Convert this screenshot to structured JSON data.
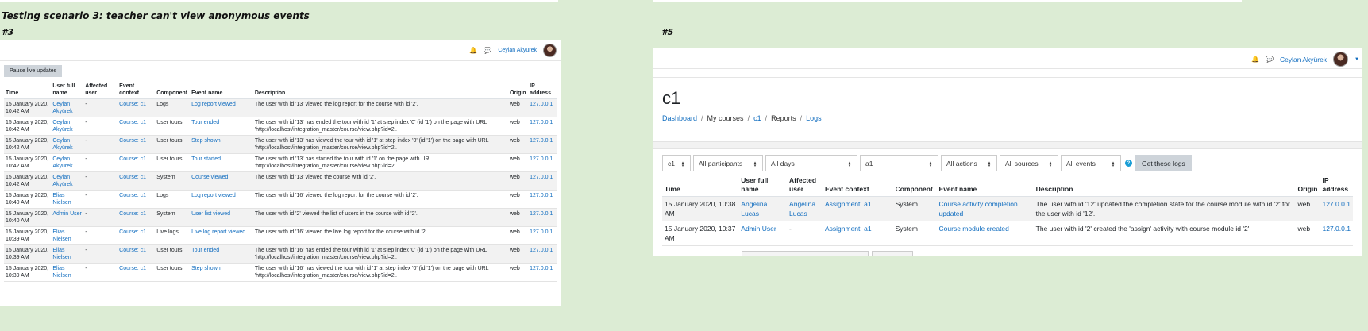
{
  "heading_title": "Testing scenario 3: teacher can't view anonymous events",
  "heading_p3": "#3",
  "heading_p5": "#5",
  "p3": {
    "user_name": "Ceylan Akyürek",
    "pause_button": "Pause live updates",
    "columns": [
      "Time",
      "User full name",
      "Affected user",
      "Event context",
      "Component",
      "Event name",
      "Description",
      "Origin",
      "IP address"
    ],
    "rows": [
      {
        "time": "15 January 2020, 10:42 AM",
        "user": "Ceylan Akyürek",
        "affected": "-",
        "context": "Course: c1",
        "component": "Logs",
        "event": "Log report viewed",
        "description": "The user with id '13' viewed the log report for the course with id '2'.",
        "origin": "web",
        "ip": "127.0.0.1"
      },
      {
        "time": "15 January 2020, 10:42 AM",
        "user": "Ceylan Akyürek",
        "affected": "-",
        "context": "Course: c1",
        "component": "User tours",
        "event": "Tour ended",
        "description": "The user with id '13' has ended the tour with id '1' at step index '0' (id '1') on the page with URL 'http://localhost/integration_master/course/view.php?id=2'.",
        "origin": "web",
        "ip": "127.0.0.1"
      },
      {
        "time": "15 January 2020, 10:42 AM",
        "user": "Ceylan Akyürek",
        "affected": "-",
        "context": "Course: c1",
        "component": "User tours",
        "event": "Step shown",
        "description": "The user with id '13' has viewed the tour with id '1' at step index '0' (id '1') on the page with URL 'http://localhost/integration_master/course/view.php?id=2'.",
        "origin": "web",
        "ip": "127.0.0.1"
      },
      {
        "time": "15 January 2020, 10:42 AM",
        "user": "Ceylan Akyürek",
        "affected": "-",
        "context": "Course: c1",
        "component": "User tours",
        "event": "Tour started",
        "description": "The user with id '13' has started the tour with id '1' on the page with URL 'http://localhost/integration_master/course/view.php?id=2'.",
        "origin": "web",
        "ip": "127.0.0.1"
      },
      {
        "time": "15 January 2020, 10:42 AM",
        "user": "Ceylan Akyürek",
        "affected": "-",
        "context": "Course: c1",
        "component": "System",
        "event": "Course viewed",
        "description": "The user with id '13' viewed the course with id '2'.",
        "origin": "web",
        "ip": "127.0.0.1"
      },
      {
        "time": "15 January 2020, 10:40 AM",
        "user": "Elias Nielsen",
        "affected": "-",
        "context": "Course: c1",
        "component": "Logs",
        "event": "Log report viewed",
        "description": "The user with id '16' viewed the log report for the course with id '2'.",
        "origin": "web",
        "ip": "127.0.0.1"
      },
      {
        "time": "15 January 2020, 10:40 AM",
        "user": "Admin User",
        "affected": "-",
        "context": "Course: c1",
        "component": "System",
        "event": "User list viewed",
        "description": "The user with id '2' viewed the list of users in the course with id '2'.",
        "origin": "web",
        "ip": "127.0.0.1"
      },
      {
        "time": "15 January 2020, 10:39 AM",
        "user": "Elias Nielsen",
        "affected": "-",
        "context": "Course: c1",
        "component": "Live logs",
        "event": "Live log report viewed",
        "description": "The user with id '16' viewed the live log report for the course with id '2'.",
        "origin": "web",
        "ip": "127.0.0.1"
      },
      {
        "time": "15 January 2020, 10:39 AM",
        "user": "Elias Nielsen",
        "affected": "-",
        "context": "Course: c1",
        "component": "User tours",
        "event": "Tour ended",
        "description": "The user with id '16' has ended the tour with id '1' at step index '0' (id '1') on the page with URL 'http://localhost/integration_master/course/view.php?id=2'.",
        "origin": "web",
        "ip": "127.0.0.1"
      },
      {
        "time": "15 January 2020, 10:39 AM",
        "user": "Elias Nielsen",
        "affected": "-",
        "context": "Course: c1",
        "component": "User tours",
        "event": "Step shown",
        "description": "The user with id '16' has viewed the tour with id '1' at step index '0' (id '1') on the page with URL 'http://localhost/integration_master/course/view.php?id=2'.",
        "origin": "web",
        "ip": "127.0.0.1"
      }
    ]
  },
  "p5": {
    "user_name": "Ceylan Akyürek",
    "course_title": "c1",
    "breadcrumb": [
      {
        "label": "Dashboard",
        "link": true
      },
      {
        "label": "My courses",
        "link": false
      },
      {
        "label": "c1",
        "link": true
      },
      {
        "label": "Reports",
        "link": false
      },
      {
        "label": "Logs",
        "link": true
      }
    ],
    "filters": [
      "c1",
      "All participants",
      "All days",
      "a1",
      "All actions",
      "All sources",
      "All events"
    ],
    "help_glyph": "?",
    "get_logs_button": "Get these logs",
    "columns": [
      "Time",
      "User full name",
      "Affected user",
      "Event context",
      "Component",
      "Event name",
      "Description",
      "Origin",
      "IP address"
    ],
    "rows": [
      {
        "time": "15 January 2020, 10:38 AM",
        "user": "Angelina Lucas",
        "affected": "Angelina Lucas",
        "context": "Assignment: a1",
        "component": "System",
        "event": "Course activity completion updated",
        "description": "The user with id '12' updated the completion state for the course module with id '2' for the user with id '12'.",
        "origin": "web",
        "ip": "127.0.0.1"
      },
      {
        "time": "15 January 2020, 10:37 AM",
        "user": "Admin User",
        "affected": "-",
        "context": "Assignment: a1",
        "component": "System",
        "event": "Course module created",
        "description": "The user with id '2' created the 'assign' activity with course module id '2'.",
        "origin": "web",
        "ip": "127.0.0.1"
      }
    ]
  },
  "icons": [
    "bell-icon",
    "chat-icon",
    "help-icon",
    "caret-down-icon"
  ]
}
